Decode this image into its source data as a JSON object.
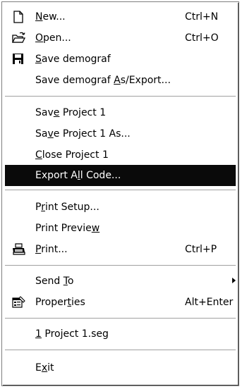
{
  "menu": {
    "items": [
      {
        "pre": "",
        "ul": "N",
        "post": "ew...",
        "accel": "Ctrl+N",
        "icon": "new-document-icon"
      },
      {
        "pre": "",
        "ul": "O",
        "post": "pen...",
        "accel": "Ctrl+O",
        "icon": "open-folder-icon"
      },
      {
        "pre": "",
        "ul": "S",
        "post": "ave demograf",
        "accel": "",
        "icon": "save-disk-icon"
      },
      {
        "pre": "Save demograf ",
        "ul": "A",
        "post": "s/Export...",
        "accel": ""
      },
      {
        "pre": "Sav",
        "ul": "e",
        "post": " Project 1",
        "accel": ""
      },
      {
        "pre": "Sa",
        "ul": "v",
        "post": "e Project 1 As...",
        "accel": ""
      },
      {
        "pre": "",
        "ul": "C",
        "post": "lose Project 1",
        "accel": ""
      },
      {
        "pre": "Export A",
        "ul": "l",
        "post": "l Code...",
        "accel": "",
        "highlighted": true
      },
      {
        "pre": "P",
        "ul": "r",
        "post": "int Setup...",
        "accel": ""
      },
      {
        "pre": "Print Previe",
        "ul": "w",
        "post": "",
        "accel": ""
      },
      {
        "pre": "",
        "ul": "P",
        "post": "rint...",
        "accel": "Ctrl+P",
        "icon": "printer-icon"
      },
      {
        "pre": "Send ",
        "ul": "T",
        "post": "o",
        "accel": "",
        "submenu": true
      },
      {
        "pre": "Proper",
        "ul": "t",
        "post": "ies",
        "accel": "Alt+Enter",
        "icon": "properties-icon"
      },
      {
        "pre": "",
        "ul": "1",
        "post": " Project 1.seg",
        "accel": ""
      },
      {
        "pre": "E",
        "ul": "x",
        "post": "it",
        "accel": ""
      }
    ]
  },
  "colors": {
    "highlight_bg": "#0a0a0a",
    "highlight_text": "#ffffff",
    "menu_bg": "#ffffff",
    "text": "#000000"
  }
}
